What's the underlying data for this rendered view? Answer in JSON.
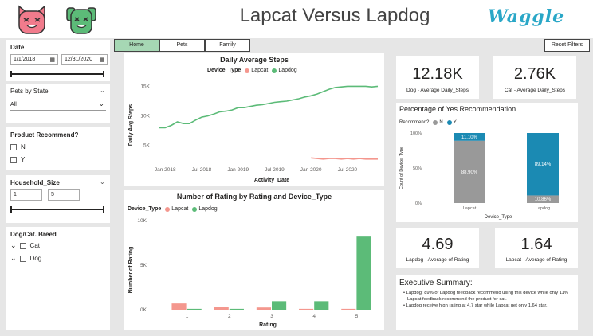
{
  "header": {
    "title": "Lapcat Versus Lapdog",
    "brand": "Waggle"
  },
  "slicers": {
    "date": {
      "title": "Date",
      "start": "1/1/2018",
      "end": "12/31/2020"
    },
    "pets_by_state": {
      "title": "Pets by State",
      "selected": "All"
    },
    "product_recommend": {
      "title": "Product Recommend?",
      "options": [
        "N",
        "Y"
      ]
    },
    "household_size": {
      "title": "Household_Size",
      "min": "1",
      "max": "5"
    },
    "breed": {
      "title": "Dog/Cat. Breed",
      "options": [
        "Cat",
        "Dog"
      ]
    }
  },
  "tabs": [
    {
      "label": "Home",
      "active": true
    },
    {
      "label": "Pets",
      "active": false
    },
    {
      "label": "Family",
      "active": false
    }
  ],
  "reset_label": "Reset Filters",
  "colors": {
    "lapcat": "#f4978e",
    "lapdog": "#5cbb78",
    "no": "#999999",
    "yes": "#1b8ab3",
    "home_tab": "#a6d7b4"
  },
  "kpis": {
    "dog_steps": {
      "value": "12.18K",
      "label": "Dog - Average Daily_Steps"
    },
    "cat_steps": {
      "value": "2.76K",
      "label": "Cat - Average Daily_Steps"
    },
    "lapdog_rating": {
      "value": "4.69",
      "label": "Lapdog - Average of Rating"
    },
    "lapcat_rating": {
      "value": "1.64",
      "label": "Lapcat - Average of Rating"
    }
  },
  "legend_title": "Device_Type",
  "legend_labels": [
    "Lapcat",
    "Lapdog"
  ],
  "recommend_legend_title": "Recommend?",
  "recommend_legend_labels": [
    "N",
    "Y"
  ],
  "summary": {
    "title": "Executive Summary:",
    "items": [
      "Lapdog: 89% of Lapdog feedback recommend using this device while only 11% Lapcat feedback recommend the product for cat.",
      "Lapdog receive high rating at 4.7 star while Lapcat get only 1.64 star."
    ]
  },
  "chart_data": [
    {
      "type": "line",
      "title": "Daily Average Steps",
      "xlabel": "Activity_Date",
      "ylabel": "Daily Avg Steps",
      "x_ticks": [
        "Jan 2018",
        "Jul 2018",
        "Jan 2019",
        "Jul 2019",
        "Jan 2020",
        "Jul 2020"
      ],
      "y_ticks": [
        "5K",
        "10K",
        "15K"
      ],
      "ylim": [
        2000,
        16000
      ],
      "xlim": [
        "2017-11",
        "2020-12"
      ],
      "series": [
        {
          "name": "Lapdog",
          "x": [
            "2017-12",
            "2018-01",
            "2018-02",
            "2018-03",
            "2018-04",
            "2018-05",
            "2018-06",
            "2018-07",
            "2018-08",
            "2018-09",
            "2018-10",
            "2018-11",
            "2018-12",
            "2019-01",
            "2019-02",
            "2019-03",
            "2019-04",
            "2019-05",
            "2019-06",
            "2019-07",
            "2019-08",
            "2019-09",
            "2019-10",
            "2019-11",
            "2019-12",
            "2020-01",
            "2020-02",
            "2020-03",
            "2020-04",
            "2020-05",
            "2020-06",
            "2020-07",
            "2020-08",
            "2020-09",
            "2020-10",
            "2020-11",
            "2020-12"
          ],
          "values": [
            8000,
            8000,
            8400,
            9000,
            8700,
            8700,
            9300,
            9800,
            10000,
            10300,
            10700,
            10800,
            11000,
            11400,
            11400,
            11600,
            11800,
            11900,
            12100,
            12300,
            12400,
            12500,
            12700,
            12900,
            13200,
            13400,
            13700,
            14100,
            14500,
            14800,
            14900,
            15000,
            15000,
            15000,
            15000,
            14900,
            15000
          ]
        },
        {
          "name": "Lapcat",
          "x": [
            "2020-01",
            "2020-02",
            "2020-03",
            "2020-04",
            "2020-05",
            "2020-06",
            "2020-07",
            "2020-08",
            "2020-09",
            "2020-10",
            "2020-11",
            "2020-12"
          ],
          "values": [
            2900,
            2800,
            2700,
            2800,
            2800,
            2700,
            2800,
            2700,
            2800,
            2700,
            2700,
            2700
          ]
        }
      ]
    },
    {
      "type": "bar",
      "title": "Number of Rating by Rating and Device_Type",
      "xlabel": "Rating",
      "ylabel": "Number of Rating",
      "categories": [
        "1",
        "2",
        "3",
        "4",
        "5"
      ],
      "y_ticks": [
        "0K",
        "5K",
        "10K"
      ],
      "ylim": [
        0,
        10000
      ],
      "series": [
        {
          "name": "Lapcat",
          "values": [
            700,
            350,
            250,
            100,
            100
          ]
        },
        {
          "name": "Lapdog",
          "values": [
            100,
            100,
            950,
            950,
            8200
          ]
        }
      ]
    },
    {
      "type": "bar",
      "title": "Percentage of Yes Recommendation",
      "xlabel": "Device_Type",
      "ylabel": "Count of Device_Type",
      "categories": [
        "Lapcat",
        "Lapdog"
      ],
      "y_ticks": [
        "0%",
        "50%",
        "100%"
      ],
      "ylim": [
        0,
        100
      ],
      "stacked": true,
      "series": [
        {
          "name": "N",
          "values": [
            88.9,
            10.86
          ],
          "labels": [
            "88.90%",
            "10.86%"
          ]
        },
        {
          "name": "Y",
          "values": [
            11.1,
            89.14
          ],
          "labels": [
            "11.10%",
            "89.14%"
          ]
        }
      ]
    }
  ]
}
